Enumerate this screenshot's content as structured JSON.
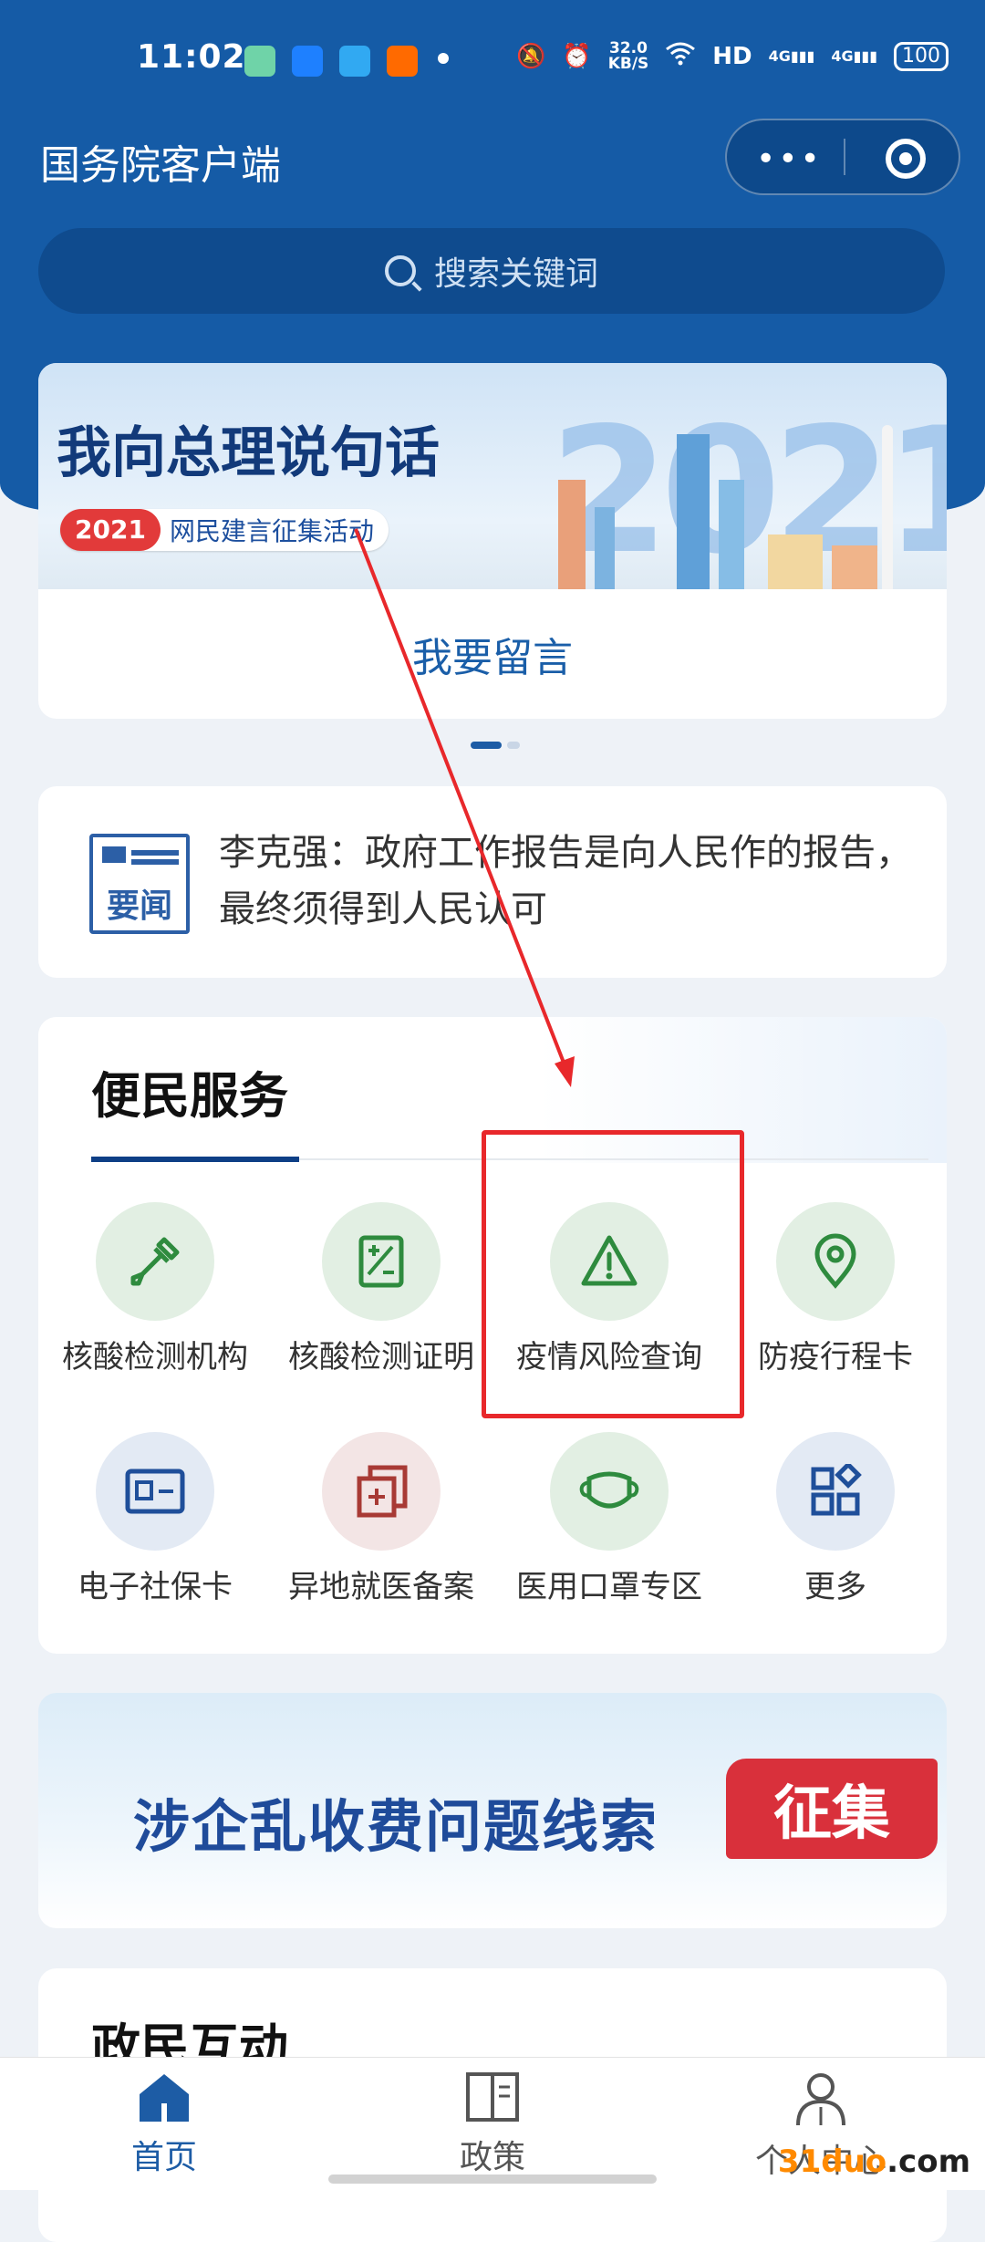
{
  "status_bar": {
    "time": "11:02",
    "net_speed_value": "32.0",
    "net_speed_unit": "KB/S",
    "hd": "HD",
    "sig1": "4G",
    "sig2": "4G",
    "battery": "100"
  },
  "app": {
    "title": "国务院客户端"
  },
  "search": {
    "placeholder": "搜索关键词"
  },
  "banner": {
    "title": "我向总理说句话",
    "year": "2021",
    "subtitle": "网民建言征集活动",
    "big_year": "2021",
    "cta": "我要留言"
  },
  "news": {
    "icon_label": "要闻",
    "headline": "李克强：政府工作报告是向人民作的报告，最终须得到人民认可"
  },
  "services": {
    "title": "便民服务",
    "items": [
      {
        "label": "核酸检测机构",
        "icon": "dropper-icon"
      },
      {
        "label": "核酸检测证明",
        "icon": "certificate-icon"
      },
      {
        "label": "疫情风险查询",
        "icon": "warning-icon"
      },
      {
        "label": "防疫行程卡",
        "icon": "location-pin-icon"
      },
      {
        "label": "电子社保卡",
        "icon": "id-card-icon"
      },
      {
        "label": "异地就医备案",
        "icon": "medical-file-icon"
      },
      {
        "label": "医用口罩专区",
        "icon": "mask-icon"
      },
      {
        "label": "更多",
        "icon": "grid-icon"
      }
    ]
  },
  "promo": {
    "text": "涉企乱收费问题线索",
    "tag": "征集"
  },
  "interaction": {
    "title": "政民互动"
  },
  "tabs": [
    {
      "label": "首页",
      "icon": "home-icon",
      "active": true
    },
    {
      "label": "政策",
      "icon": "book-icon",
      "active": false
    },
    {
      "label": "个人中心",
      "icon": "user-icon",
      "active": false
    }
  ],
  "watermark": {
    "part1": "31",
    "part2": "duo",
    "part3": ".com"
  },
  "colors": {
    "header": "#155ba6",
    "primary_dark": "#0e3f86",
    "green": "#2e8b3e",
    "annotation_red": "#e8282b"
  }
}
